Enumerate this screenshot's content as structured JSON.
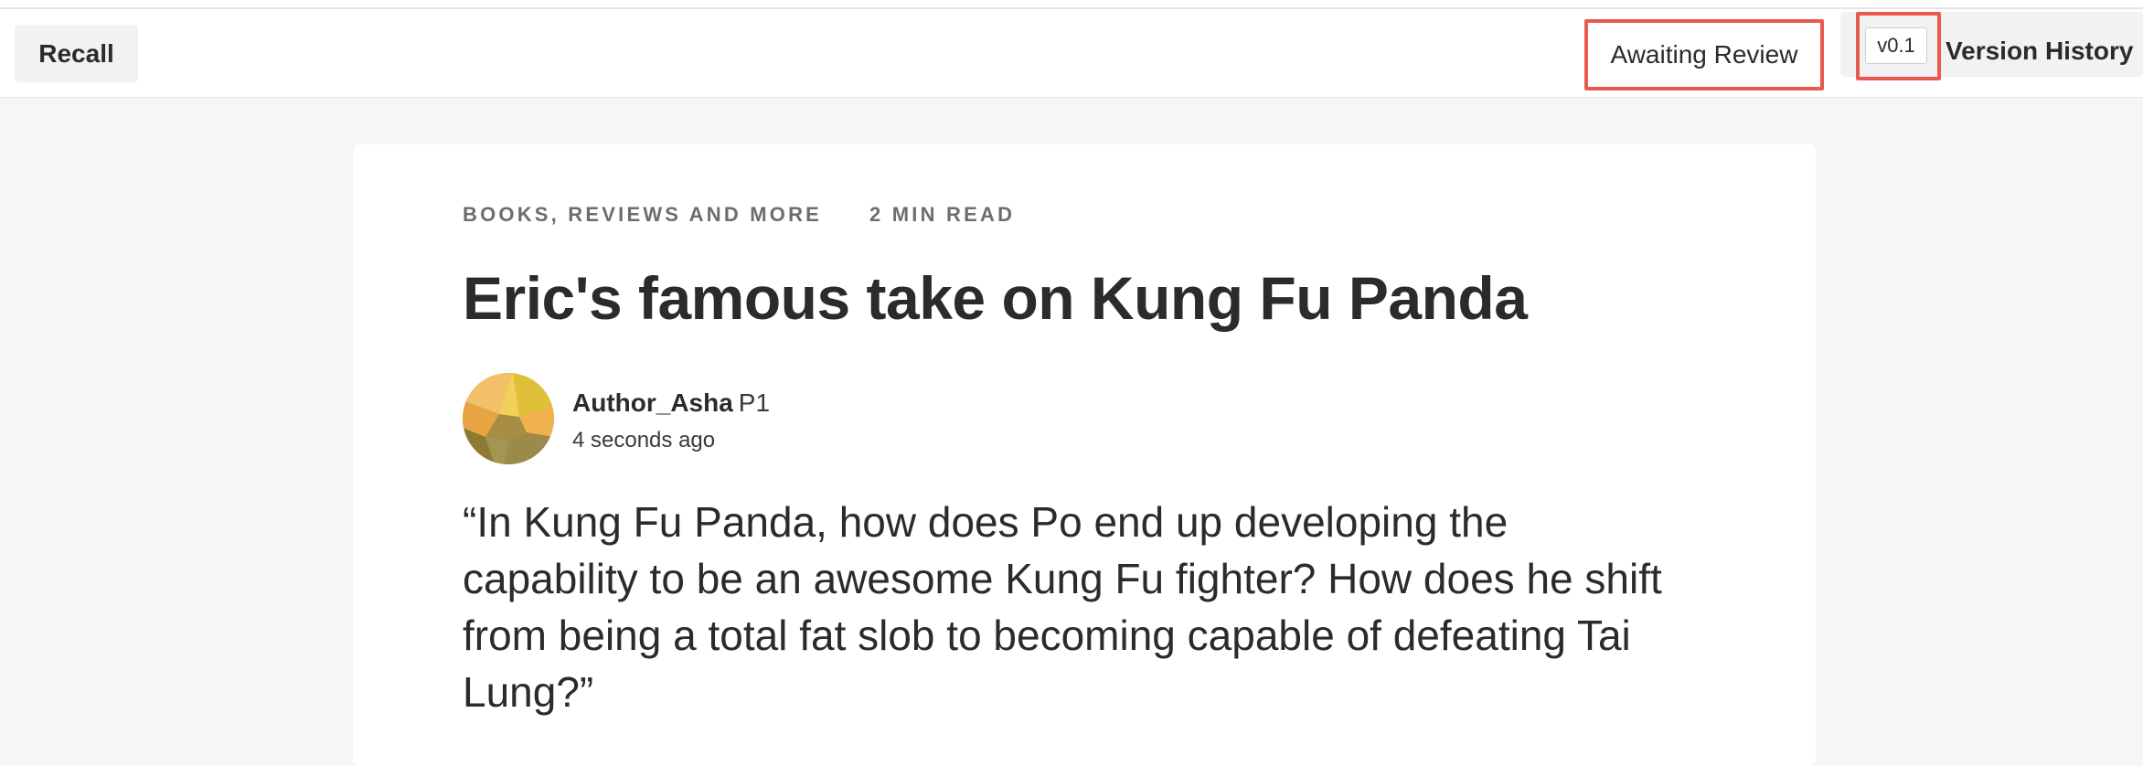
{
  "toolbar": {
    "recall_label": "Recall",
    "status_label": "Awaiting Review",
    "version_badge": "v0.1",
    "version_history_label": "Version History"
  },
  "article": {
    "category": "BOOKS, REVIEWS AND MORE",
    "read_time": "2 MIN READ",
    "title": "Eric's famous take on Kung Fu Panda",
    "author": {
      "name": "Author_Asha",
      "badge": "P1",
      "timestamp": "4 seconds ago",
      "avatar_icon": "geometric-avatar-icon"
    },
    "body": "“In Kung Fu Panda, how does Po end up developing the capability to be an awesome Kung Fu fighter? How does he shift from being a total fat slob to becoming capable of defeating Tai Lung?”"
  },
  "colors": {
    "highlight": "#e85a50",
    "background": "#f6f6f6",
    "card": "#ffffff",
    "text": "#2b2b2b",
    "meta_text": "#6d6d6d"
  }
}
